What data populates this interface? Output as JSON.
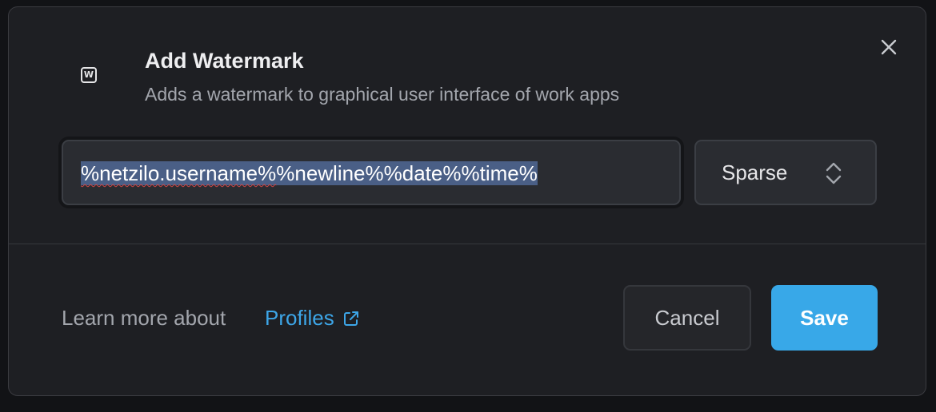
{
  "dialog": {
    "icon_letter": "W",
    "title": "Add Watermark",
    "subtitle": "Adds a watermark to graphical user interface of work apps",
    "close_icon": "close-icon"
  },
  "watermark": {
    "value_part1": "%netzilo.username%",
    "value_part2": "%newline%%date%%time%",
    "selected": true,
    "spellcheck_flagged": "netzilo.username"
  },
  "density": {
    "selected": "Sparse",
    "icon": "chevron-up-down-icon"
  },
  "footer": {
    "learn_more_prefix": "Learn more about",
    "link_label": "Profiles",
    "link_icon": "external-link-icon"
  },
  "buttons": {
    "cancel_label": "Cancel",
    "save_label": "Save"
  },
  "colors": {
    "background": "#1e1f23",
    "accent": "#38a8e8",
    "link": "#3da6e8",
    "selection": "#4a5f86"
  }
}
